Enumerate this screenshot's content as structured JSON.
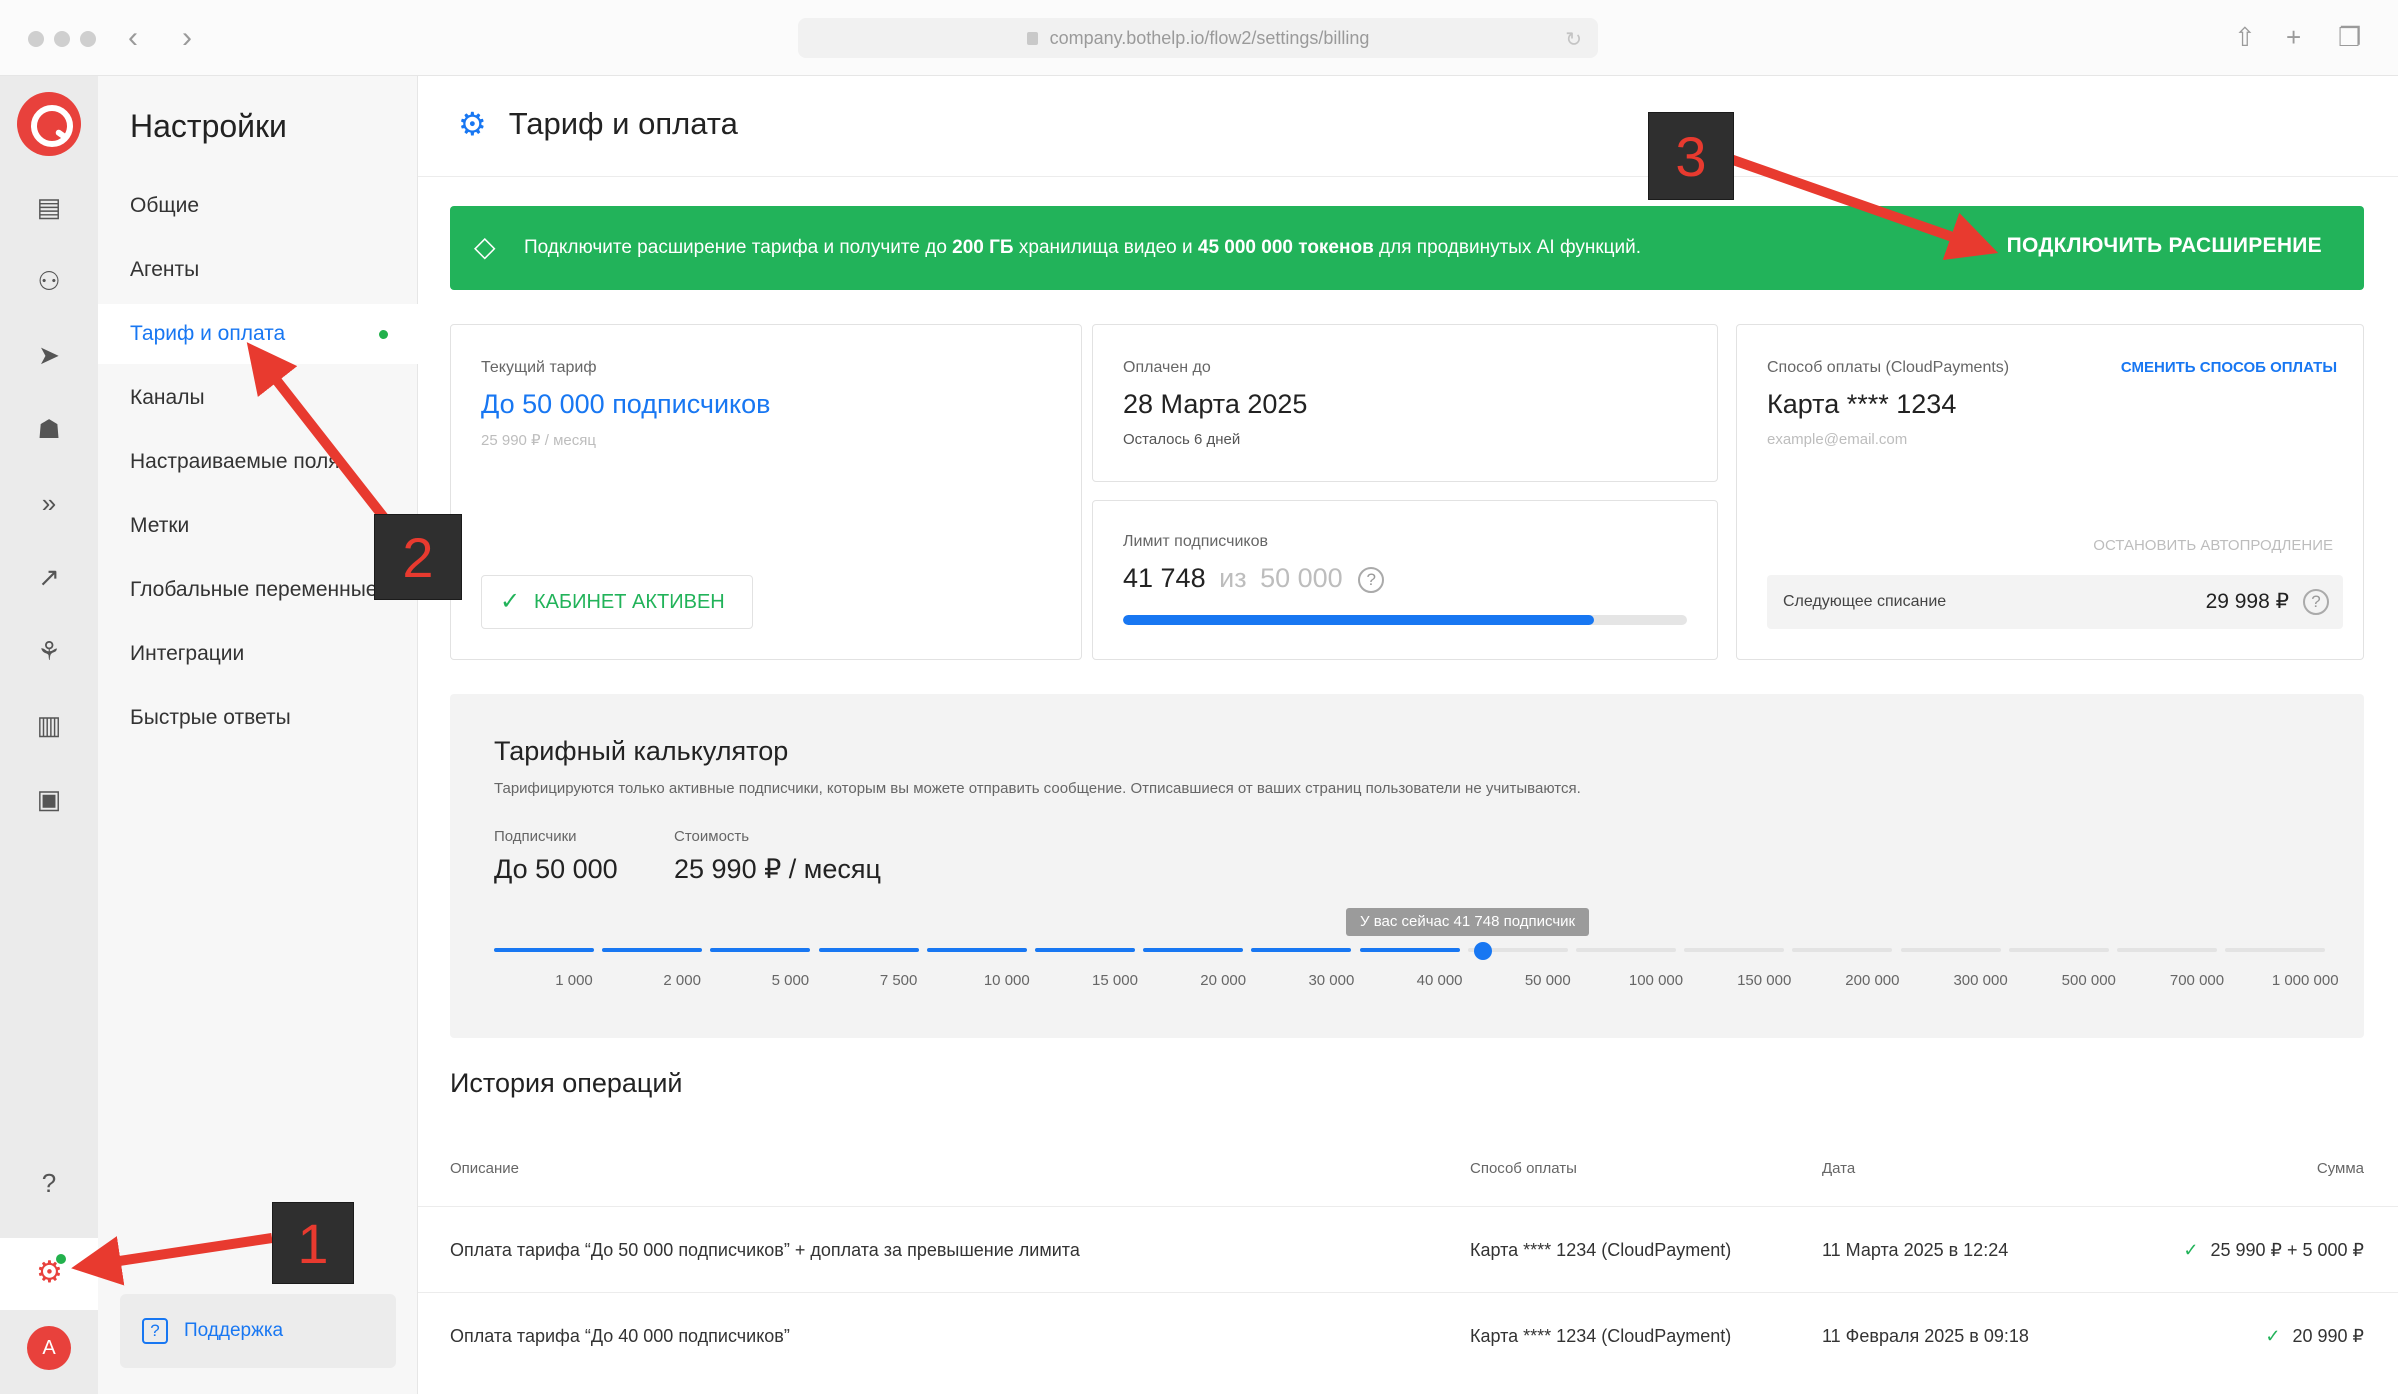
{
  "browser": {
    "url": "company.bothelp.io/flow2/settings/billing"
  },
  "rail": {
    "icons": [
      "chat-icon",
      "users-icon",
      "send-icon",
      "bot-icon",
      "flows-icon",
      "trend-icon",
      "integration-icon",
      "stats-icon",
      "archive-icon",
      "help-icon",
      "settings-icon"
    ],
    "avatar_letter": "A"
  },
  "sidebar": {
    "title": "Настройки",
    "items": [
      {
        "label": "Общие"
      },
      {
        "label": "Агенты"
      },
      {
        "label": "Тариф и оплата",
        "active": true
      },
      {
        "label": "Каналы"
      },
      {
        "label": "Настраиваемые поля"
      },
      {
        "label": "Метки"
      },
      {
        "label": "Глобальные переменные"
      },
      {
        "label": "Интеграции"
      },
      {
        "label": "Быстрые ответы"
      }
    ],
    "support_label": "Поддержка"
  },
  "page": {
    "title": "Тариф и оплата"
  },
  "banner": {
    "text_pre": "Подключите расширение тарифа и получите до ",
    "storage": "200 ГБ",
    "text_mid": " хранилища видео и ",
    "tokens": "45 000 000 токенов",
    "text_post": " для продвинутых AI функций.",
    "button": "ПОДКЛЮЧИТЬ РАСШИРЕНИЕ"
  },
  "current_plan": {
    "label": "Текущий тариф",
    "name": "До 50 000 подписчиков",
    "price": "25 990 ₽ / месяц",
    "status": "КАБИНЕТ АКТИВЕН"
  },
  "paid_until": {
    "label": "Оплачен до",
    "date": "28 Марта 2025",
    "remaining": "Осталось 6 дней"
  },
  "subscribers_limit": {
    "label": "Лимит подписчиков",
    "current": "41 748",
    "of": "из",
    "max": "50 000",
    "fill_fraction": 0.835
  },
  "payment_method": {
    "label": "Способ оплаты (CloudPayments)",
    "change_link": "СМЕНИТЬ СПОСОБ ОПЛАТЫ",
    "card": "Карта **** 1234",
    "email": "example@email.com",
    "stop_autorenew": "ОСТАНОВИТЬ АВТОПРОДЛЕНИЕ",
    "next_charge_label": "Следующее списание",
    "next_charge_amount": "29 998 ₽"
  },
  "calculator": {
    "title": "Тарифный калькулятор",
    "description": "Тарифицируются только активные подписчики, которым вы можете отправить сообщение. Отписавшиеся от ваших страниц пользователи не учитываются.",
    "subscribers_label": "Подписчики",
    "subscribers_value": "До 50 000",
    "cost_label": "Стоимость",
    "cost_value": "25 990 ₽ / месяц",
    "tooltip": "У вас сейчас 41 748 подписчик",
    "steps": [
      "1 000",
      "2 000",
      "5 000",
      "7 500",
      "10 000",
      "15 000",
      "20 000",
      "30 000",
      "40 000",
      "50 000",
      "100 000",
      "150 000",
      "200 000",
      "300 000",
      "500 000",
      "700 000",
      "1 000 000"
    ],
    "active_step_count": 9
  },
  "history": {
    "title": "История операций",
    "columns": [
      "Описание",
      "Способ оплаты",
      "Дата",
      "Сумма"
    ],
    "rows": [
      {
        "description": "Оплата тарифа “До 50 000 подписчиков” + доплата за превышение лимита",
        "method": "Карта **** 1234 (CloudPayment)",
        "date": "11 Марта 2025 в 12:24",
        "amount": "25 990 ₽ + 5 000 ₽"
      },
      {
        "description": "Оплата тарифа “До 40 000 подписчиков”",
        "method": "Карта **** 1234 (CloudPayment)",
        "date": "11 Февраля 2025 в 09:18",
        "amount": "20 990 ₽"
      }
    ]
  },
  "annotations": [
    "1",
    "2",
    "3"
  ],
  "colors": {
    "accent": "#1877f2",
    "success": "#22b35a",
    "brand": "#e8413c",
    "annotation": "#e83a2f"
  }
}
